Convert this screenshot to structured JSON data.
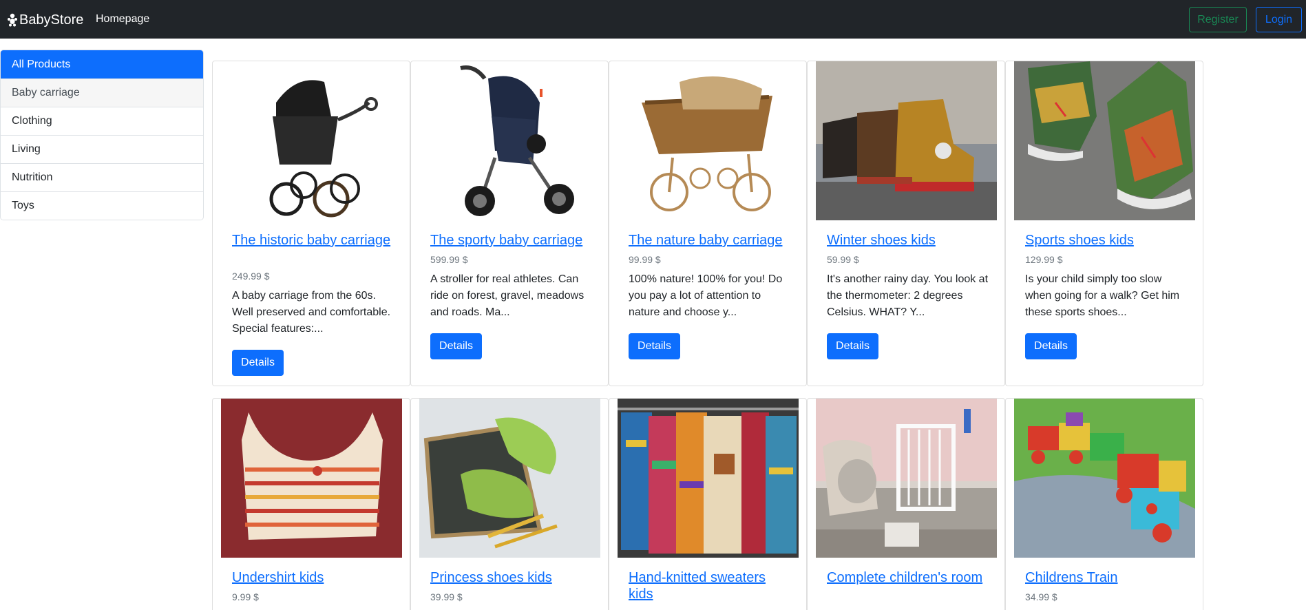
{
  "navbar": {
    "brand": "BabyStore",
    "homepage": "Homepage",
    "register": "Register",
    "login": "Login"
  },
  "sidebar": {
    "items": [
      {
        "label": "All Products"
      },
      {
        "label": "Baby carriage"
      },
      {
        "label": "Clothing"
      },
      {
        "label": "Living"
      },
      {
        "label": "Nutrition"
      },
      {
        "label": "Toys"
      }
    ]
  },
  "products": [
    {
      "title": "The historic baby carriage",
      "price": "249.99 $",
      "description": "A baby carriage from the 60s. Well preserved and comfortable. Special features:...",
      "button": "Details",
      "image": "vintage-black-pram"
    },
    {
      "title": "The sporty baby carriage",
      "price": "599.99 $",
      "description": "A stroller for real athletes. Can ride on forest, gravel, meadows and roads. Ma...",
      "button": "Details",
      "image": "jogging-stroller"
    },
    {
      "title": "The nature baby carriage",
      "price": "99.99 $",
      "description": "100% nature! 100% for you! Do you pay a lot of attention to nature and choose y...",
      "button": "Details",
      "image": "wicker-pram"
    },
    {
      "title": "Winter shoes kids",
      "price": "59.99 $",
      "description": "It's another rainy day. You look at the thermometer: 2 degrees Celsius. WHAT? Y...",
      "button": "Details",
      "image": "winter-boots"
    },
    {
      "title": "Sports shoes kids",
      "price": "129.99 $",
      "description": "Is your child simply too slow when going for a walk? Get him these sports shoes...",
      "button": "Details",
      "image": "sneakers"
    },
    {
      "title": "Undershirt kids",
      "price": "9.99 $",
      "image": "striped-undershirt"
    },
    {
      "title": "Princess shoes kids",
      "price": "39.99 $",
      "image": "green-shoes"
    },
    {
      "title": "Hand-knitted sweaters kids",
      "price": "",
      "image": "knitted-sweaters"
    },
    {
      "title": "Complete children's room",
      "price": "",
      "image": "nursery-room"
    },
    {
      "title": "Childrens Train",
      "price": "34.99 $",
      "image": "toy-train"
    }
  ],
  "colors": {
    "navbar": "#212529",
    "primary": "#0d6efd",
    "success": "#198754",
    "muted": "#6c757d"
  }
}
